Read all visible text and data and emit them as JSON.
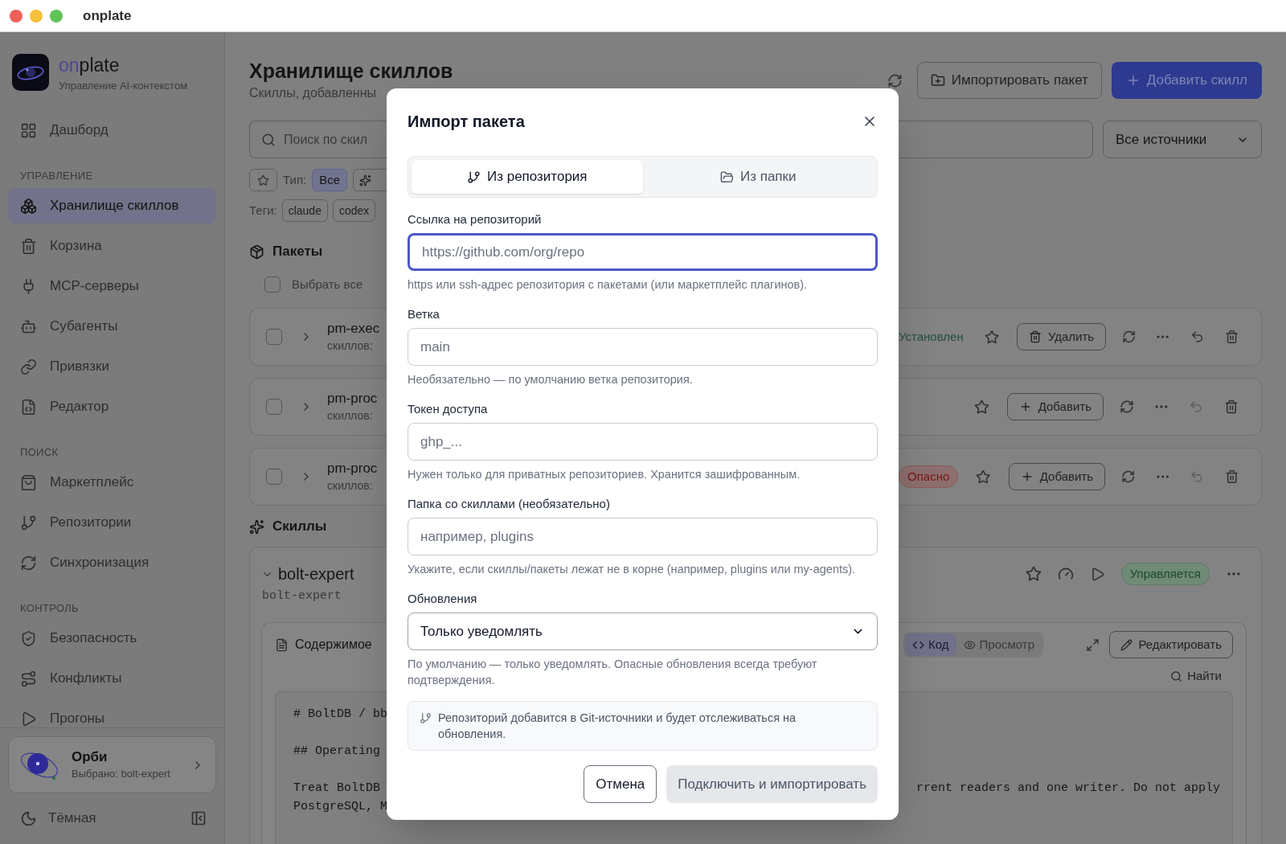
{
  "window": {
    "title": "onplate"
  },
  "sidebar": {
    "brand": {
      "accent": "on",
      "rest": "plate"
    },
    "tagline": "Управление AI-контекстом",
    "groups": [
      {
        "items": [
          {
            "label": "Дашборд",
            "selected": false
          }
        ]
      },
      {
        "heading": "УПРАВЛЕНИЕ",
        "items": [
          {
            "label": "Хранилище скиллов",
            "selected": true
          },
          {
            "label": "Корзина",
            "selected": false
          },
          {
            "label": "MCP-серверы",
            "selected": false
          },
          {
            "label": "Субагенты",
            "selected": false
          },
          {
            "label": "Привязки",
            "selected": false
          },
          {
            "label": "Редактор",
            "selected": false
          }
        ]
      },
      {
        "heading": "ПОИСК",
        "items": [
          {
            "label": "Маркетплейс",
            "selected": false
          },
          {
            "label": "Репозитории",
            "selected": false
          },
          {
            "label": "Синхронизация",
            "selected": false
          }
        ]
      },
      {
        "heading": "КОНТРОЛЬ",
        "items": [
          {
            "label": "Безопасность",
            "selected": false
          },
          {
            "label": "Конфликты",
            "selected": false
          },
          {
            "label": "Прогоны",
            "selected": false
          }
        ]
      }
    ],
    "assistant": {
      "name": "Орби",
      "subtitle": "Выбрано: bolt-expert"
    },
    "theme_toggle": "Тёмная"
  },
  "page": {
    "title": "Хранилище скиллов",
    "subtitle": "Скиллы, добавленны",
    "import_button": "Импортировать пакет",
    "add_button": "Добавить скилл",
    "search": {
      "placeholder": "Поиск по скил"
    },
    "source_filter": "Все источники",
    "type_label": "Тип:",
    "type_options": [
      {
        "kind": "text",
        "label": "Все",
        "selected": true
      },
      {
        "kind": "icon",
        "selected": false
      }
    ],
    "tags_label": "Теги:",
    "tags": [
      "claude",
      "codex"
    ],
    "packages": {
      "title": "Пакеты",
      "select_all": {
        "label": "Выбрать все",
        "checked": false
      },
      "rows": [
        {
          "name": "pm-exec",
          "count": "скиллов:",
          "checked": false,
          "status": {
            "kind": "installed",
            "label": "Установлен"
          },
          "action": {
            "kind": "remove",
            "label": "Удалить"
          },
          "undo_enabled": true
        },
        {
          "name": "pm-proc",
          "count": "скиллов:",
          "checked": false,
          "action": {
            "kind": "add",
            "label": "Добавить"
          },
          "undo_enabled": false
        },
        {
          "name": "pm-proc",
          "count": "скиллов:",
          "checked": false,
          "status": {
            "kind": "danger",
            "label": "Опасно"
          },
          "action": {
            "kind": "add",
            "label": "Добавить"
          },
          "undo_enabled": false
        }
      ]
    },
    "skills": {
      "title": "Скиллы",
      "items": [
        {
          "name": "bolt-expert",
          "slug": "bolt-expert",
          "expanded": true,
          "status": "Управляется",
          "content_title": "Содержимое",
          "view_tabs": [
            {
              "label": "Код",
              "selected": true
            },
            {
              "label": "Просмотр",
              "selected": false
            }
          ],
          "edit_button": "Редактировать",
          "find_button": "Найти",
          "code_lines": [
            {
              "kind": "text",
              "left": "# BoltDB / bb"
            },
            {
              "kind": "blank"
            },
            {
              "kind": "text",
              "left": "## Operating"
            },
            {
              "kind": "blank"
            },
            {
              "kind": "text",
              "left": "Treat BoltDB",
              "right": "rrent readers and one writer. Do not apply"
            },
            {
              "kind": "text",
              "left": "PostgreSQL, M"
            }
          ]
        }
      ]
    }
  },
  "dialog": {
    "title": "Импорт пакета",
    "tabs": [
      {
        "label": "Из репозитория",
        "selected": true
      },
      {
        "label": "Из папки",
        "selected": false
      }
    ],
    "fields": [
      {
        "kind": "input",
        "label": "Ссылка на репозиторий",
        "placeholder": "https://github.com/org/repo",
        "focused": true,
        "help": "https или ssh-адрес репозитория с пакетами (или маркетплейс плагинов)."
      },
      {
        "kind": "input",
        "label": "Ветка",
        "placeholder": "main",
        "focused": false,
        "help": "Необязательно — по умолчанию ветка репозитория."
      },
      {
        "kind": "input",
        "label": "Токен доступа",
        "placeholder": "ghp_...",
        "focused": false,
        "help": "Нужен только для приватных репозиториев. Хранится зашифрованным."
      },
      {
        "kind": "input",
        "label": "Папка со скиллами (необязательно)",
        "placeholder": "например, plugins",
        "focused": false,
        "help": "Укажите, если скиллы/пакеты лежат не в корне (например, plugins или my-agents)."
      },
      {
        "kind": "select",
        "label": "Обновления",
        "value": "Только уведомлять",
        "help": "По умолчанию — только уведомлять. Опасные обновления всегда требуют подтверждения."
      }
    ],
    "note": "Репозиторий добавится в Git-источники и будет отслеживаться на обновления.",
    "buttons": [
      {
        "kind": "secondary",
        "label": "Отмена",
        "disabled": false
      },
      {
        "kind": "primary",
        "label": "Подключить и импортировать",
        "disabled": true
      }
    ]
  }
}
